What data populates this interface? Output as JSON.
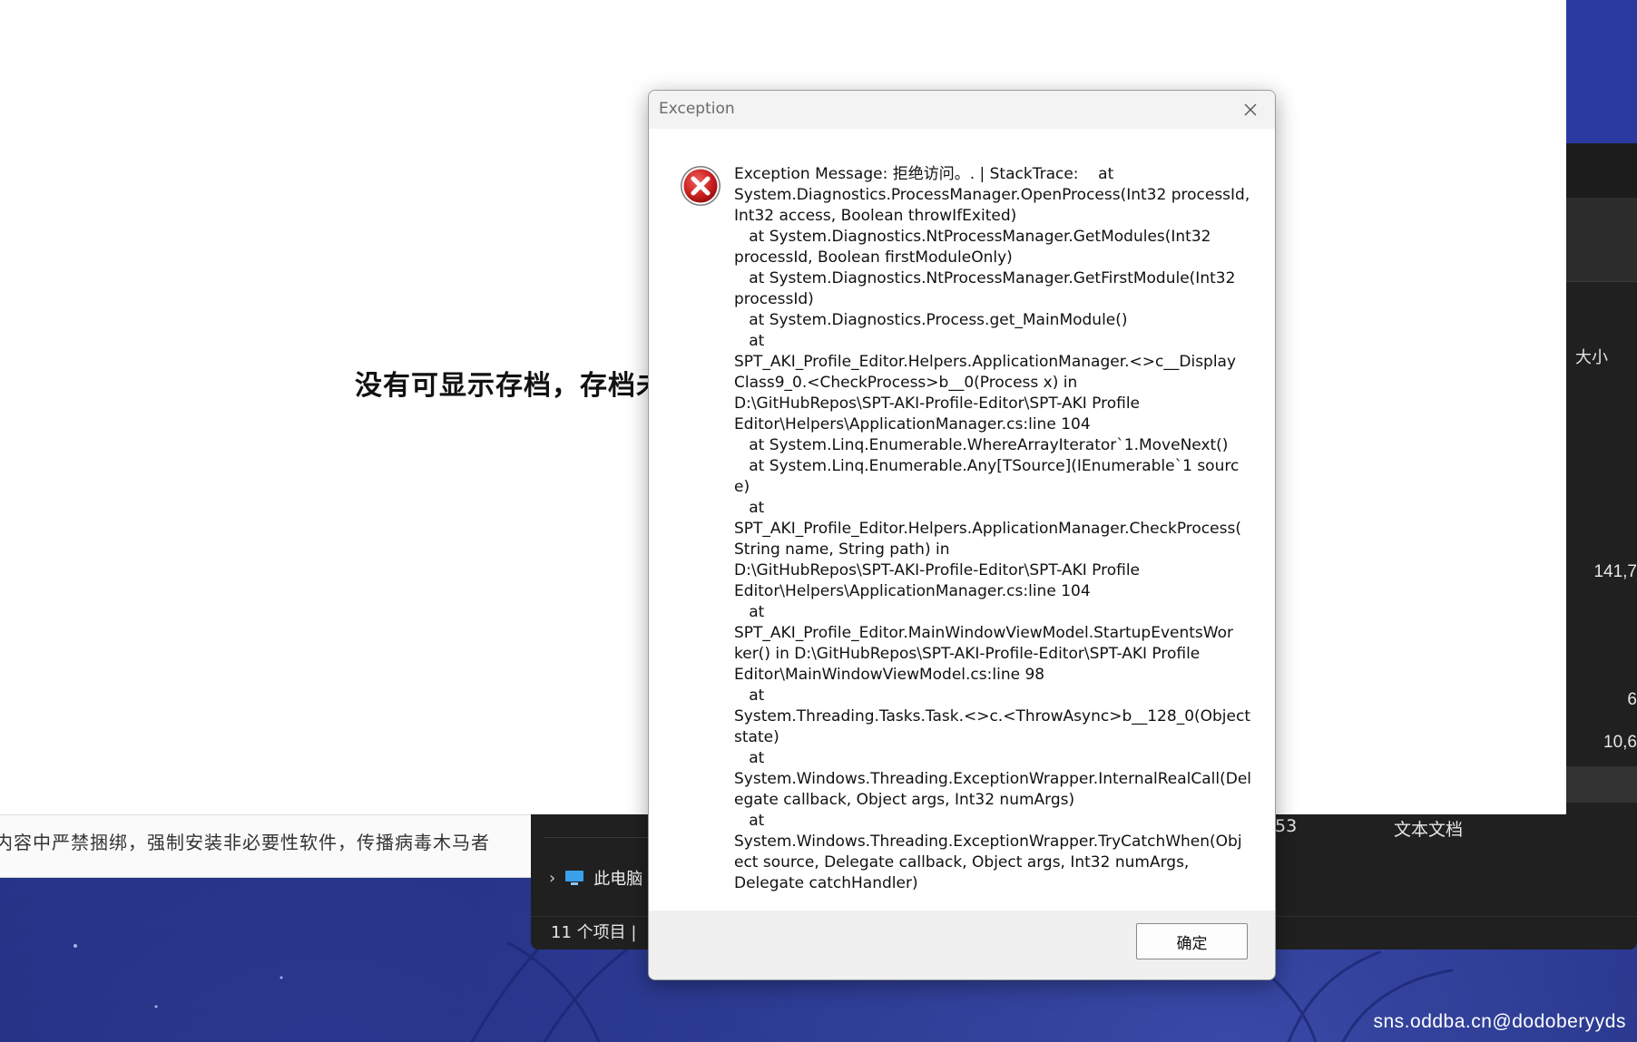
{
  "background_app": {
    "empty_message": "没有可显示存档，存档未"
  },
  "notice_strip": {
    "text": "内容中严禁捆绑，强制安装非必要性软件，传播病毒木马者"
  },
  "explorer": {
    "column_header_size": "大小",
    "size_values": [
      "141,7",
      "6",
      "10,6"
    ],
    "row_date_fragment": "53",
    "row_type": "文本文档",
    "nav_item_label": "此电脑",
    "status_text": "11 个项目  |"
  },
  "dialog": {
    "title": "Exception",
    "message": "Exception Message: 拒绝访问。. | StackTrace:    at\nSystem.Diagnostics.ProcessManager.OpenProcess(Int32 processId,\nInt32 access, Boolean throwIfExited)\n   at System.Diagnostics.NtProcessManager.GetModules(Int32\nprocessId, Boolean firstModuleOnly)\n   at System.Diagnostics.NtProcessManager.GetFirstModule(Int32\nprocessId)\n   at System.Diagnostics.Process.get_MainModule()\n   at\nSPT_AKI_Profile_Editor.Helpers.ApplicationManager.<>c__Display\nClass9_0.<CheckProcess>b__0(Process x) in\nD:\\GitHubRepos\\SPT-AKI-Profile-Editor\\SPT-AKI Profile\nEditor\\Helpers\\ApplicationManager.cs:line 104\n   at System.Linq.Enumerable.WhereArrayIterator`1.MoveNext()\n   at System.Linq.Enumerable.Any[TSource](IEnumerable`1 source)\n   at\nSPT_AKI_Profile_Editor.Helpers.ApplicationManager.CheckProcess(\nString name, String path) in\nD:\\GitHubRepos\\SPT-AKI-Profile-Editor\\SPT-AKI Profile\nEditor\\Helpers\\ApplicationManager.cs:line 104\n   at\nSPT_AKI_Profile_Editor.MainWindowViewModel.StartupEventsWor\nker() in D:\\GitHubRepos\\SPT-AKI-Profile-Editor\\SPT-AKI Profile\nEditor\\MainWindowViewModel.cs:line 98\n   at\nSystem.Threading.Tasks.Task.<>c.<ThrowAsync>b__128_0(Object\nstate)\n   at\nSystem.Windows.Threading.ExceptionWrapper.InternalRealCall(Del\negate callback, Object args, Int32 numArgs)\n   at\nSystem.Windows.Threading.ExceptionWrapper.TryCatchWhen(Obj\nect source, Delegate callback, Object args, Int32 numArgs,\nDelegate catchHandler)",
    "ok_label": "确定",
    "icon": "error-icon",
    "close_icon": "close-icon"
  },
  "watermark": "sns.oddba.cn@dodoberyyds",
  "colors": {
    "wallpaper": "#2b3a9a",
    "explorer_bg": "#202020",
    "dialog_footer": "#f0f0f0",
    "error_red": "#d32f2f"
  }
}
